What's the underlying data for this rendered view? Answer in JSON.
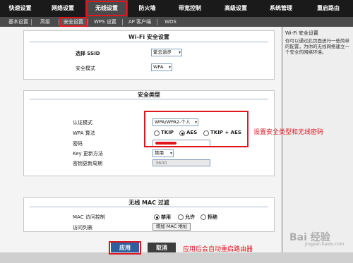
{
  "nav": {
    "tabs": [
      {
        "label": "快速设置"
      },
      {
        "label": "网络设置"
      },
      {
        "label": "无线设置"
      },
      {
        "label": "防火墙"
      },
      {
        "label": "带宽控制"
      },
      {
        "label": "高级设置"
      },
      {
        "label": "系统管理"
      },
      {
        "label": "重启路由"
      }
    ],
    "active_tab_index": 2
  },
  "subnav": {
    "items": [
      {
        "label": "基本设置"
      },
      {
        "label": "高级"
      },
      {
        "label": "安全设置"
      },
      {
        "label": "WPS 设置"
      },
      {
        "label": "AP 客户端"
      },
      {
        "label": "WDS"
      }
    ],
    "active_index": 2
  },
  "wifi_security": {
    "title": "Wi-Fi 安全设置",
    "ssid_label": "选择 SSID",
    "ssid_value": "紫云逍步",
    "mode_label": "安全模式",
    "mode_value": "WPA"
  },
  "security_type": {
    "title": "安全类型",
    "auth_label": "认证模式",
    "auth_value": "WPA/WPA2-个人",
    "algo_label": "WPA 算法",
    "algo_options": [
      "TKIP",
      "AES",
      "TKIP + AES"
    ],
    "algo_selected_index": 1,
    "password_label": "密码",
    "key_update_label": "Key 更新方法",
    "key_update_value": "禁用",
    "key_period_label": "密钥更新周期",
    "key_period_value": "3600"
  },
  "mac_filter": {
    "title": "无线 MAC 过滤",
    "access_label": "MAC 访问控制",
    "access_options": [
      "禁用",
      "允许",
      "拒绝"
    ],
    "access_selected_index": 0,
    "list_label": "访问列表",
    "add_button": "增加 MAC 地址"
  },
  "actions": {
    "apply": "应用",
    "cancel": "取消"
  },
  "help": {
    "title": "Wi-Fi 安全设置",
    "text": "你可以通过此页面进行一些简单的配置，为你的无线网络建立一个安全的网络环境。"
  },
  "annotations": {
    "security_note": "设置安全类型和无线密码",
    "apply_note": "应用后会自动重启路由器"
  },
  "watermark": {
    "text": "Bai 经验",
    "sub": "jingyan.baidu.com"
  },
  "colors": {
    "nav_bg": "#1a1a1a",
    "highlight": "#e0161f",
    "apply_bg": "#2f5f9e",
    "cancel_bg": "#3d3d3d"
  }
}
